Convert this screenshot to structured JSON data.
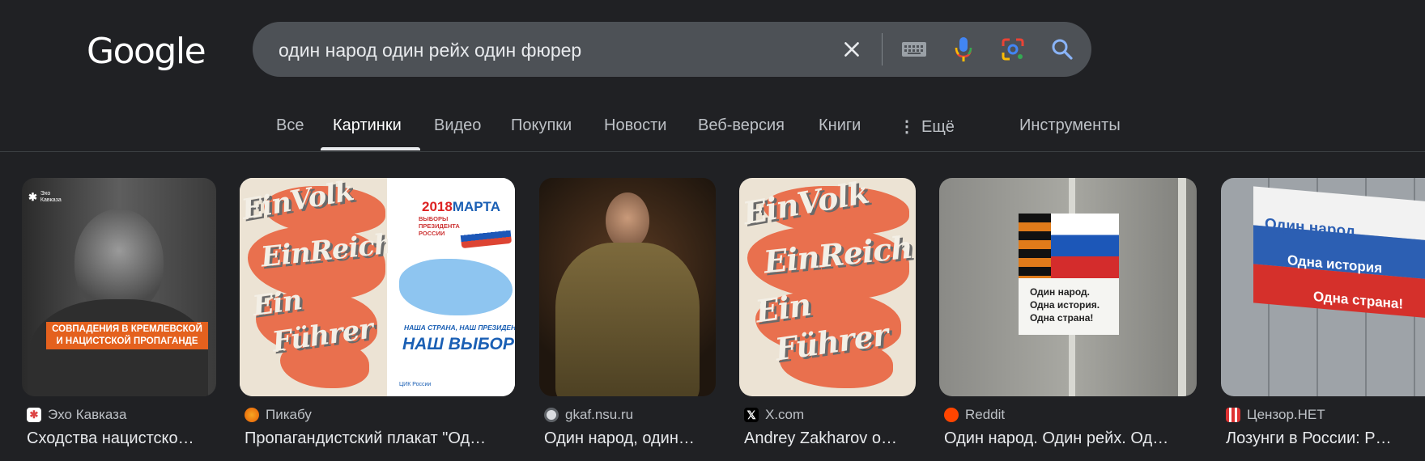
{
  "logo": "Google",
  "search": {
    "query": "один народ один рейх один фюрер"
  },
  "tabs": [
    {
      "label": "Все"
    },
    {
      "label": "Картинки"
    },
    {
      "label": "Видео"
    },
    {
      "label": "Покупки"
    },
    {
      "label": "Новости"
    },
    {
      "label": "Веб-версия"
    },
    {
      "label": "Книги"
    },
    {
      "label": "Ещё"
    }
  ],
  "tools_label": "Инструменты",
  "results": [
    {
      "source": "Эхо Кавказа",
      "caption": "Сходства нацистско…",
      "overlay_text": "СОВПАДЕНИЯ В КРЕМЛЕВСКОЙ И НАЦИСТСКОЙ ПРОПАГАНДЕ",
      "logo_text": "Эхо Кавказа"
    },
    {
      "source": "Пикабу",
      "caption": "Пропагандистский плакат \"Од…",
      "poster_words": [
        "EinVolk",
        "EinReich",
        "Ein",
        "Führer"
      ],
      "right_panel": {
        "year": "2018",
        "month": "МАРТА",
        "heading": "ВЫБОРЫ ПРЕЗИДЕНТА РОССИИ",
        "slogan_small": "НАША СТРАНА, НАШ ПРЕЗИДЕНТ",
        "slogan_big": "НАШ ВЫБОР",
        "footer": "ЦИК России"
      }
    },
    {
      "source": "gkaf.nsu.ru",
      "caption": "Один народ, один…"
    },
    {
      "source": "X.com",
      "caption": "Andrey Zakharov o…",
      "poster_words": [
        "EinVolk",
        "EinReich",
        "Ein",
        "Führer"
      ]
    },
    {
      "source": "Reddit",
      "caption": "Один народ. Один рейх. Од…",
      "poster_lines": [
        "Один народ.",
        "Одна история.",
        "Одна страна!"
      ]
    },
    {
      "source": "Цензор.НЕТ",
      "caption": "Лозунги в России: Р…",
      "banner_lines": [
        "Один народ",
        "Одна история",
        "Одна страна!"
      ]
    }
  ],
  "colors": {
    "bg": "#202124",
    "search_bg": "#4d5156",
    "poster_orange": "#e9704e",
    "mic_blue": "#4285f4",
    "lens": "#ea4335"
  }
}
